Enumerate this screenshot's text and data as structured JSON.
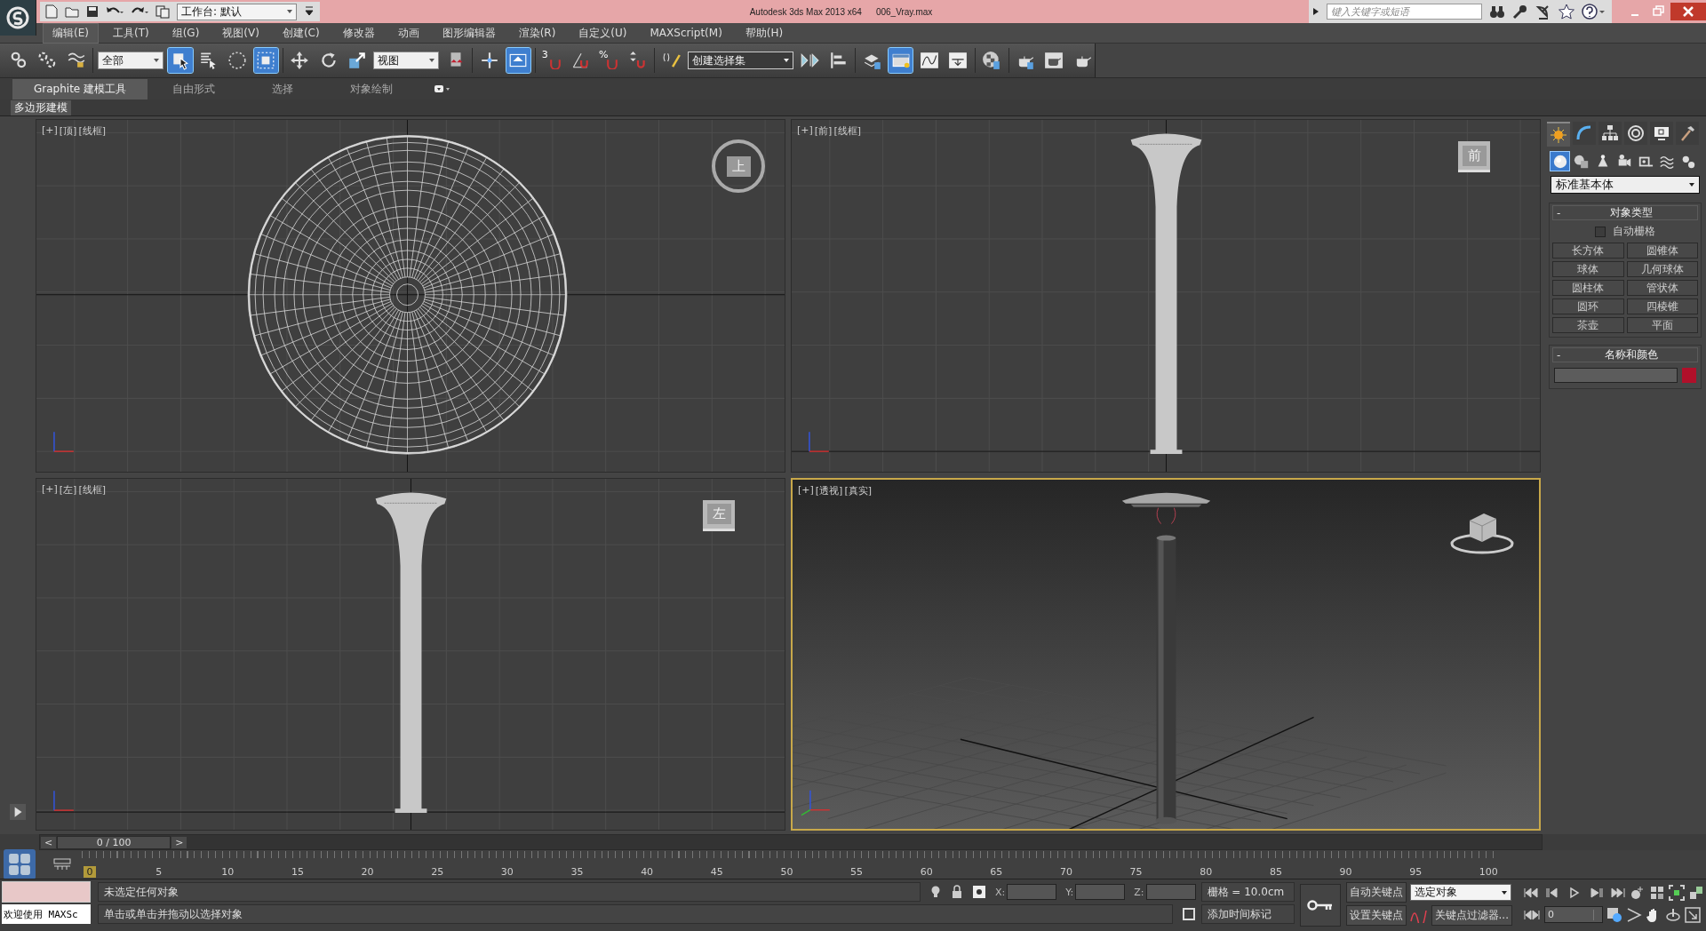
{
  "title_bar": {
    "workspace": "工作台: 默认",
    "app_title": "Autodesk 3ds Max 2013 x64",
    "file_name": "006_Vray.max",
    "search": {
      "placeholder": "键入关键字或短语"
    }
  },
  "menu": [
    {
      "label": "编辑(E)",
      "selected": true
    },
    {
      "label": "工具(T)",
      "selected": false
    },
    {
      "label": "组(G)",
      "selected": false
    },
    {
      "label": "视图(V)",
      "selected": false
    },
    {
      "label": "创建(C)",
      "selected": false
    },
    {
      "label": "修改器",
      "selected": false
    },
    {
      "label": "动画",
      "selected": false
    },
    {
      "label": "图形编辑器",
      "selected": false
    },
    {
      "label": "渲染(R)",
      "selected": false
    },
    {
      "label": "自定义(U)",
      "selected": false
    },
    {
      "label": "MAXScript(M)",
      "selected": false
    },
    {
      "label": "帮助(H)",
      "selected": false
    }
  ],
  "toolbar": [
    {
      "kind": "link",
      "selected": false
    },
    {
      "kind": "unlink",
      "selected": false
    },
    {
      "kind": "bind",
      "selected": false
    },
    {
      "kind": "sep"
    },
    {
      "kind": "dropdown",
      "value": "全部"
    },
    {
      "kind": "select",
      "selected": true
    },
    {
      "kind": "select-name",
      "selected": false
    },
    {
      "kind": "region",
      "selected": false
    },
    {
      "kind": "window",
      "selected": true
    },
    {
      "kind": "sep"
    },
    {
      "kind": "move",
      "selected": false
    },
    {
      "kind": "rotate",
      "selected": false
    },
    {
      "kind": "scale",
      "selected": false
    },
    {
      "kind": "dropdown",
      "value": "视图"
    },
    {
      "kind": "pivot",
      "selected": false
    },
    {
      "kind": "sep"
    },
    {
      "kind": "select-manip",
      "selected": false
    },
    {
      "kind": "manipulate",
      "selected": true
    },
    {
      "kind": "sep"
    },
    {
      "kind": "snap",
      "label": "3",
      "selected": false
    },
    {
      "kind": "angle-snap",
      "selected": false
    },
    {
      "kind": "percent-snap",
      "label": "%",
      "selected": false
    },
    {
      "kind": "spinner-snap",
      "selected": false
    },
    {
      "kind": "sep"
    },
    {
      "kind": "edit-named",
      "selected": false
    },
    {
      "kind": "dropdown-dark",
      "value": "创建选择集"
    },
    {
      "kind": "mirror",
      "selected": false
    },
    {
      "kind": "align",
      "selected": false
    },
    {
      "kind": "sep"
    },
    {
      "kind": "layer",
      "selected": false
    },
    {
      "kind": "ribbon",
      "selected": true
    },
    {
      "kind": "curve",
      "selected": false
    },
    {
      "kind": "schematic",
      "selected": false
    },
    {
      "kind": "sep"
    },
    {
      "kind": "material",
      "selected": false
    },
    {
      "kind": "sep"
    },
    {
      "kind": "render-setup",
      "selected": false
    },
    {
      "kind": "render-frame",
      "selected": false
    },
    {
      "kind": "render",
      "selected": false
    }
  ],
  "ribbon": {
    "tabs": [
      {
        "label": "Graphite 建模工具",
        "selected": true
      },
      {
        "label": "自由形式",
        "selected": false
      },
      {
        "label": "选择",
        "selected": false
      },
      {
        "label": "对象绘制",
        "selected": false
      }
    ],
    "panel": "多边形建模"
  },
  "viewports": [
    {
      "kind": "top",
      "active": false,
      "labels": [
        "[+]",
        "[顶]",
        "[线框]"
      ],
      "cube": "上"
    },
    {
      "kind": "front",
      "active": false,
      "labels": [
        "[+]",
        "[前]",
        "[线框]"
      ],
      "cube": "前"
    },
    {
      "kind": "left",
      "active": false,
      "labels": [
        "[+]",
        "[左]",
        "[线框]"
      ],
      "cube": "左"
    },
    {
      "kind": "perspective",
      "active": true,
      "labels": [
        "[+]",
        "[透视]",
        "[真实]"
      ]
    }
  ],
  "command_panel": {
    "tabs": [
      {
        "kind": "create",
        "selected": true
      },
      {
        "kind": "modify",
        "selected": false
      },
      {
        "kind": "hierarchy",
        "selected": false
      },
      {
        "kind": "motion",
        "selected": false
      },
      {
        "kind": "display",
        "selected": false
      },
      {
        "kind": "utilities",
        "selected": false
      }
    ],
    "categories": [
      {
        "kind": "geometry",
        "selected": true
      },
      {
        "kind": "shapes",
        "selected": false
      },
      {
        "kind": "lights",
        "selected": false
      },
      {
        "kind": "cameras",
        "selected": false
      },
      {
        "kind": "helpers",
        "selected": false
      },
      {
        "kind": "spacewarps",
        "selected": false
      },
      {
        "kind": "systems",
        "selected": false
      }
    ],
    "subcategory": "标准基本体",
    "object_type": {
      "title": "对象类型",
      "collapse": "-",
      "autogrid": {
        "label": "自动栅格",
        "checked": false
      },
      "buttons": [
        "长方体",
        "圆锥体",
        "球体",
        "几何球体",
        "圆柱体",
        "管状体",
        "圆环",
        "四棱锥",
        "茶壶",
        "平面"
      ]
    },
    "name_color": {
      "title": "名称和颜色",
      "collapse": "-",
      "color": "#b0102a"
    }
  },
  "timeline": {
    "slider": "0 / 100",
    "prev": "<",
    "next": ">",
    "ticks": [
      "0",
      "5",
      "10",
      "15",
      "20",
      "25",
      "30",
      "35",
      "40",
      "45",
      "50",
      "55",
      "60",
      "65",
      "70",
      "75",
      "80",
      "85",
      "90",
      "95",
      "100"
    ]
  },
  "status": {
    "listener": "欢迎使用 MAXSc",
    "selection": "未选定任何对象",
    "prompt": "单击或单击并拖动以选择对象",
    "coords": [
      "X:",
      "Y:",
      "Z:"
    ],
    "grid": "栅格 = 10.0cm",
    "add_tag": "添加时间标记",
    "auto_key": "自动关键点",
    "set_key": "设置关键点",
    "key_mode": "选定对象",
    "key_filters": "关键点过滤器...",
    "frame": "0"
  }
}
